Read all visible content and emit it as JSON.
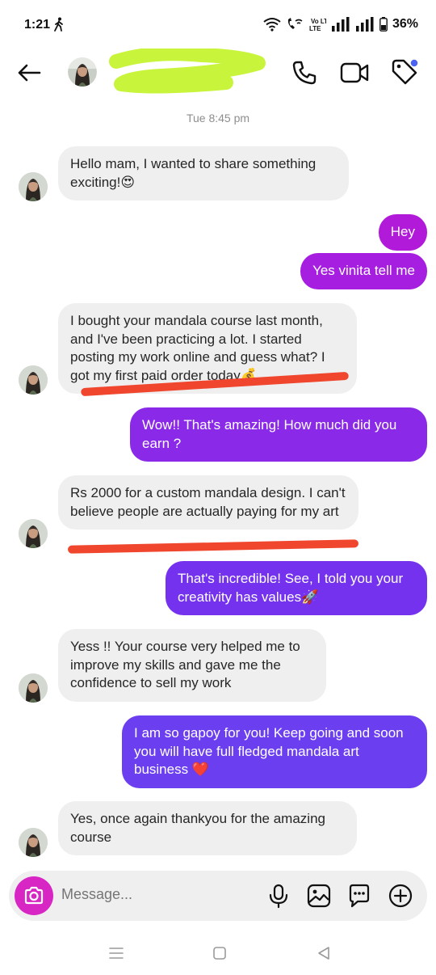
{
  "status_bar": {
    "time": "1:21",
    "battery": "36%",
    "network": "Vo LTE"
  },
  "header": {
    "back_icon": "arrow-left-icon",
    "call_icon": "phone-icon",
    "video_icon": "video-camera-icon",
    "tag_icon": "tag-icon"
  },
  "thread": {
    "date_stamp": "Tue 8:45 pm",
    "messages": [
      {
        "side": "in",
        "text": "Hello mam, I wanted to share something exciting!😍"
      },
      {
        "side": "out",
        "text": "Hey"
      },
      {
        "side": "out",
        "text": "Yes vinita tell me"
      },
      {
        "side": "in",
        "text": "I bought your mandala course last month, and I've been practicing a lot. I started posting my work online and guess what? I got my first paid order today💰"
      },
      {
        "side": "out",
        "text": "Wow!! That's amazing! How much did you earn ?"
      },
      {
        "side": "in",
        "text": "Rs 2000 for a custom mandala design. I can't believe people are actually paying for my art"
      },
      {
        "side": "out",
        "text": "That's incredible! See, I told you your creativity has values🚀"
      },
      {
        "side": "in",
        "text": "Yess !! Your course very helped me to improve my skills and gave me the confidence to sell my work"
      },
      {
        "side": "out",
        "text": "I am so gapoy for you! Keep going and soon you will have full fledged mandala art business ❤️"
      },
      {
        "side": "in",
        "text": "Yes, once again thankyou for the amazing course"
      }
    ]
  },
  "composer": {
    "placeholder": "Message..."
  },
  "colors": {
    "bubble_out_magenta": "#b11ad9",
    "bubble_out_purple": "#7b2ef0",
    "bubble_out_violet": "#6b3ef0",
    "bubble_in": "#efefef",
    "underline": "#f0462e",
    "camera": "#d826c4"
  }
}
